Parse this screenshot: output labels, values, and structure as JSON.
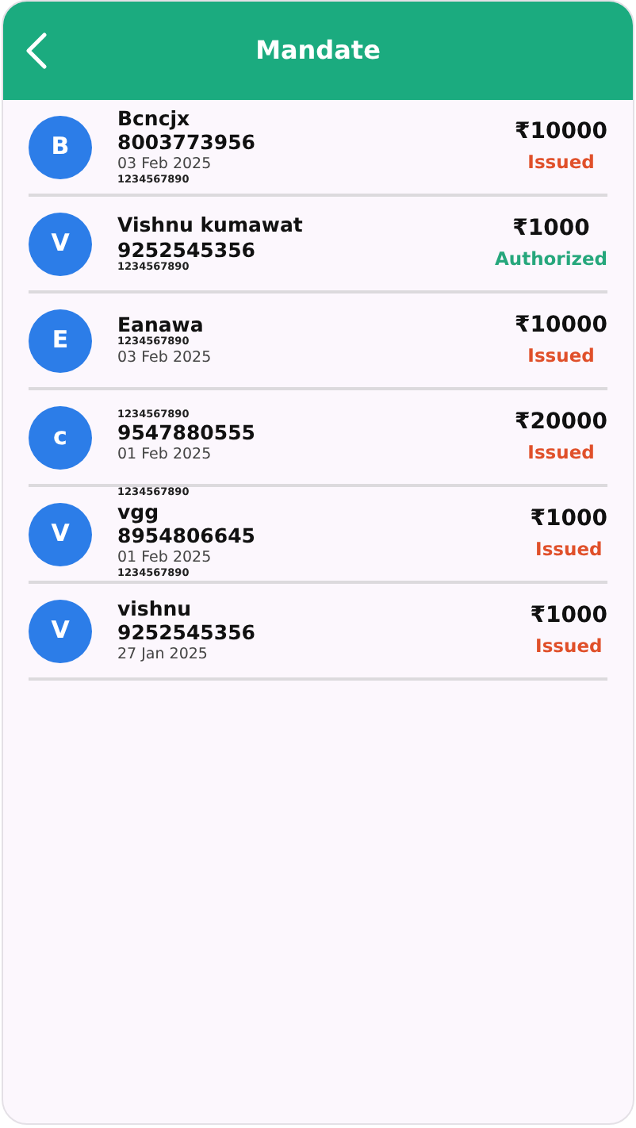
{
  "header": {
    "title": "Mandate"
  },
  "mandates": [
    {
      "initial": "B",
      "lines": [
        {
          "kind": "name",
          "text": "Bcncjx"
        },
        {
          "kind": "phone",
          "text": "8003773956"
        },
        {
          "kind": "date",
          "text": "03 Feb 2025"
        },
        {
          "kind": "code",
          "text": "1234567890"
        }
      ],
      "amount": "₹10000",
      "status": "Issued",
      "kind": "issued"
    },
    {
      "initial": "V",
      "lines": [
        {
          "kind": "name",
          "text": "Vishnu kumawat"
        },
        {
          "kind": "phone",
          "text": "9252545356"
        },
        {
          "kind": "code",
          "text": "1234567890"
        }
      ],
      "amount": "₹1000",
      "status": "Authorized",
      "kind": "authorized"
    },
    {
      "initial": "E",
      "lines": [
        {
          "kind": "name",
          "text": "Eanawa"
        },
        {
          "kind": "code",
          "text": "1234567890"
        },
        {
          "kind": "date",
          "text": "03 Feb 2025"
        }
      ],
      "amount": "₹10000",
      "status": "Issued",
      "kind": "issued"
    },
    {
      "initial": "c",
      "lines": [
        {
          "kind": "code",
          "text": "1234567890"
        },
        {
          "kind": "phone",
          "text": "9547880555"
        },
        {
          "kind": "date",
          "text": "01 Feb 2025"
        }
      ],
      "amount": "₹20000",
      "status": "Issued",
      "kind": "issued"
    },
    {
      "initial": "V",
      "lines": [
        {
          "kind": "code",
          "text": "1234567890"
        },
        {
          "kind": "name",
          "text": "vgg"
        },
        {
          "kind": "phone",
          "text": "8954806645"
        },
        {
          "kind": "date",
          "text": "01 Feb 2025"
        },
        {
          "kind": "code",
          "text": "1234567890"
        }
      ],
      "amount": "₹1000",
      "status": "Issued",
      "kind": "issued"
    },
    {
      "initial": "V",
      "lines": [
        {
          "kind": "name",
          "text": "vishnu"
        },
        {
          "kind": "phone",
          "text": "9252545356"
        },
        {
          "kind": "date",
          "text": "27 Jan 2025"
        }
      ],
      "amount": "₹1000",
      "status": "Issued",
      "kind": "issued"
    }
  ]
}
